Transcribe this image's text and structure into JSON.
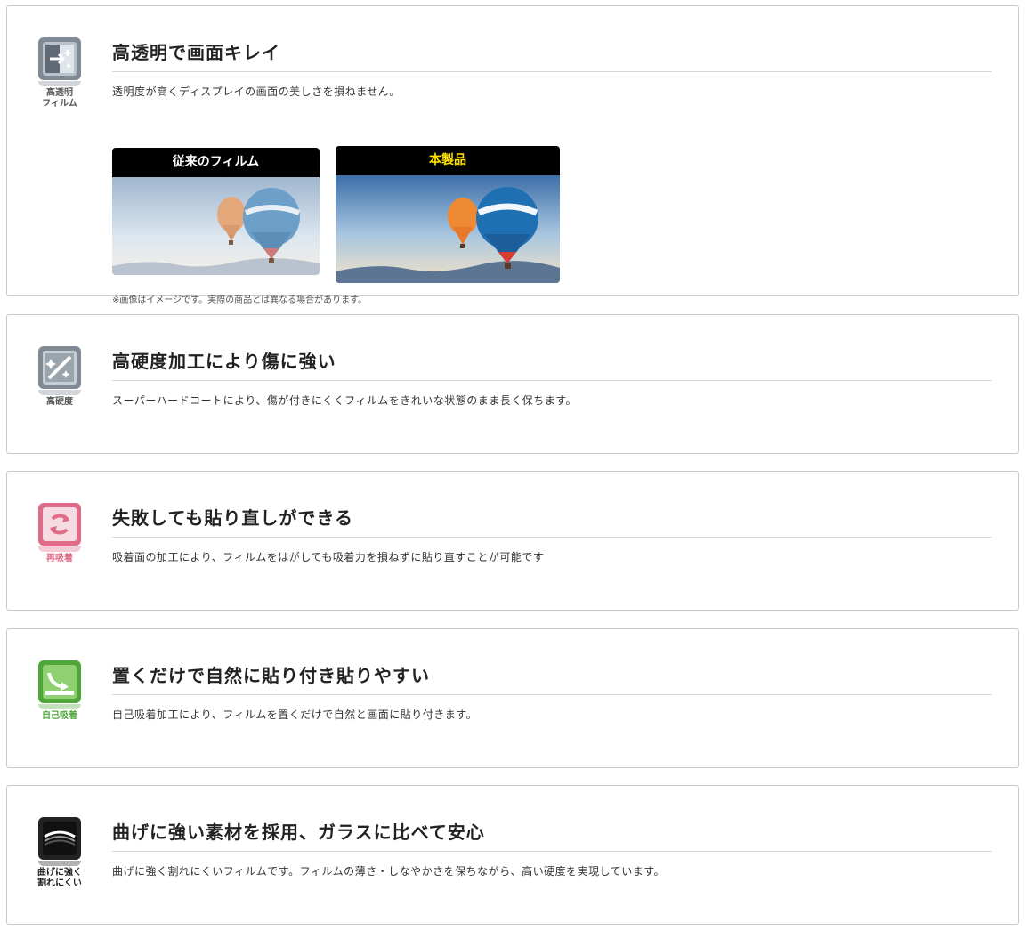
{
  "features": [
    {
      "icon": "transparency-icon",
      "icon_label": "高透明\nフィルム",
      "accent": "#7f8a95",
      "title": "高透明で画面キレイ",
      "description": "透明度が高くディスプレイの画面の美しさを損ねません。",
      "comparison": {
        "old_label": "従来のフィルム",
        "new_label": "本製品",
        "new_label_color": "#ffe100",
        "note": "※画像はイメージです。実際の商品とは異なる場合があります。"
      }
    },
    {
      "icon": "hardness-icon",
      "icon_label": "高硬度",
      "accent": "#7f8a95",
      "title": "高硬度加工により傷に強い",
      "description": "スーパーハードコートにより、傷が付きにくくフィルムをきれいな状態のまま長く保ちます。"
    },
    {
      "icon": "reattach-icon",
      "icon_label": "再吸着",
      "accent": "#e06b86",
      "title": "失敗しても貼り直しができる",
      "description": "吸着面の加工により、フィルムをはがしても吸着力を損ねずに貼り直すことが可能です"
    },
    {
      "icon": "self-adhesion-icon",
      "icon_label": "自己吸着",
      "accent": "#4fa73a",
      "title": "置くだけで自然に貼り付き貼りやすい",
      "description": "自己吸着加工により、フィルムを置くだけで自然と画面に貼り付きます。"
    },
    {
      "icon": "flexible-icon",
      "icon_label": "曲げに強く\n割れにくい",
      "accent": "#222222",
      "title": "曲げに強い素材を採用、ガラスに比べて安心",
      "description": "曲げに強く割れにくいフィルムです。フィルムの薄さ・しなやかさを保ちながら、高い硬度を実現しています。"
    }
  ]
}
